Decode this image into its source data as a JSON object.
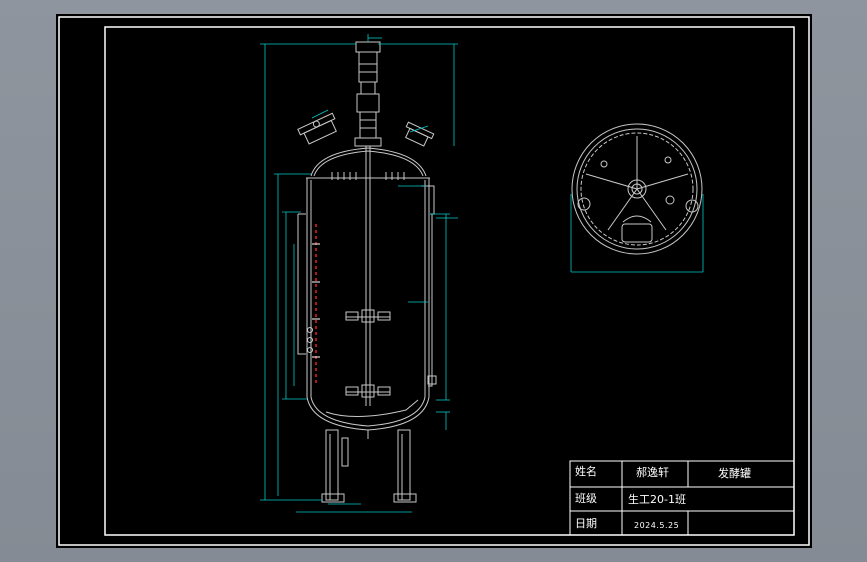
{
  "colors": {
    "background": "#8b919a",
    "sheet": "#000000",
    "line": "#ffffff",
    "dimension": "#00c8c8",
    "hidden": "#ff2020",
    "part": "#c8c8c8"
  },
  "title_block": {
    "name_label": "姓名",
    "name_value": "郝逸轩",
    "drawing_title": "发酵罐",
    "class_label": "班级",
    "class_value": "生工20-1班",
    "date_label": "日期",
    "date_value": "2024.5.25"
  }
}
